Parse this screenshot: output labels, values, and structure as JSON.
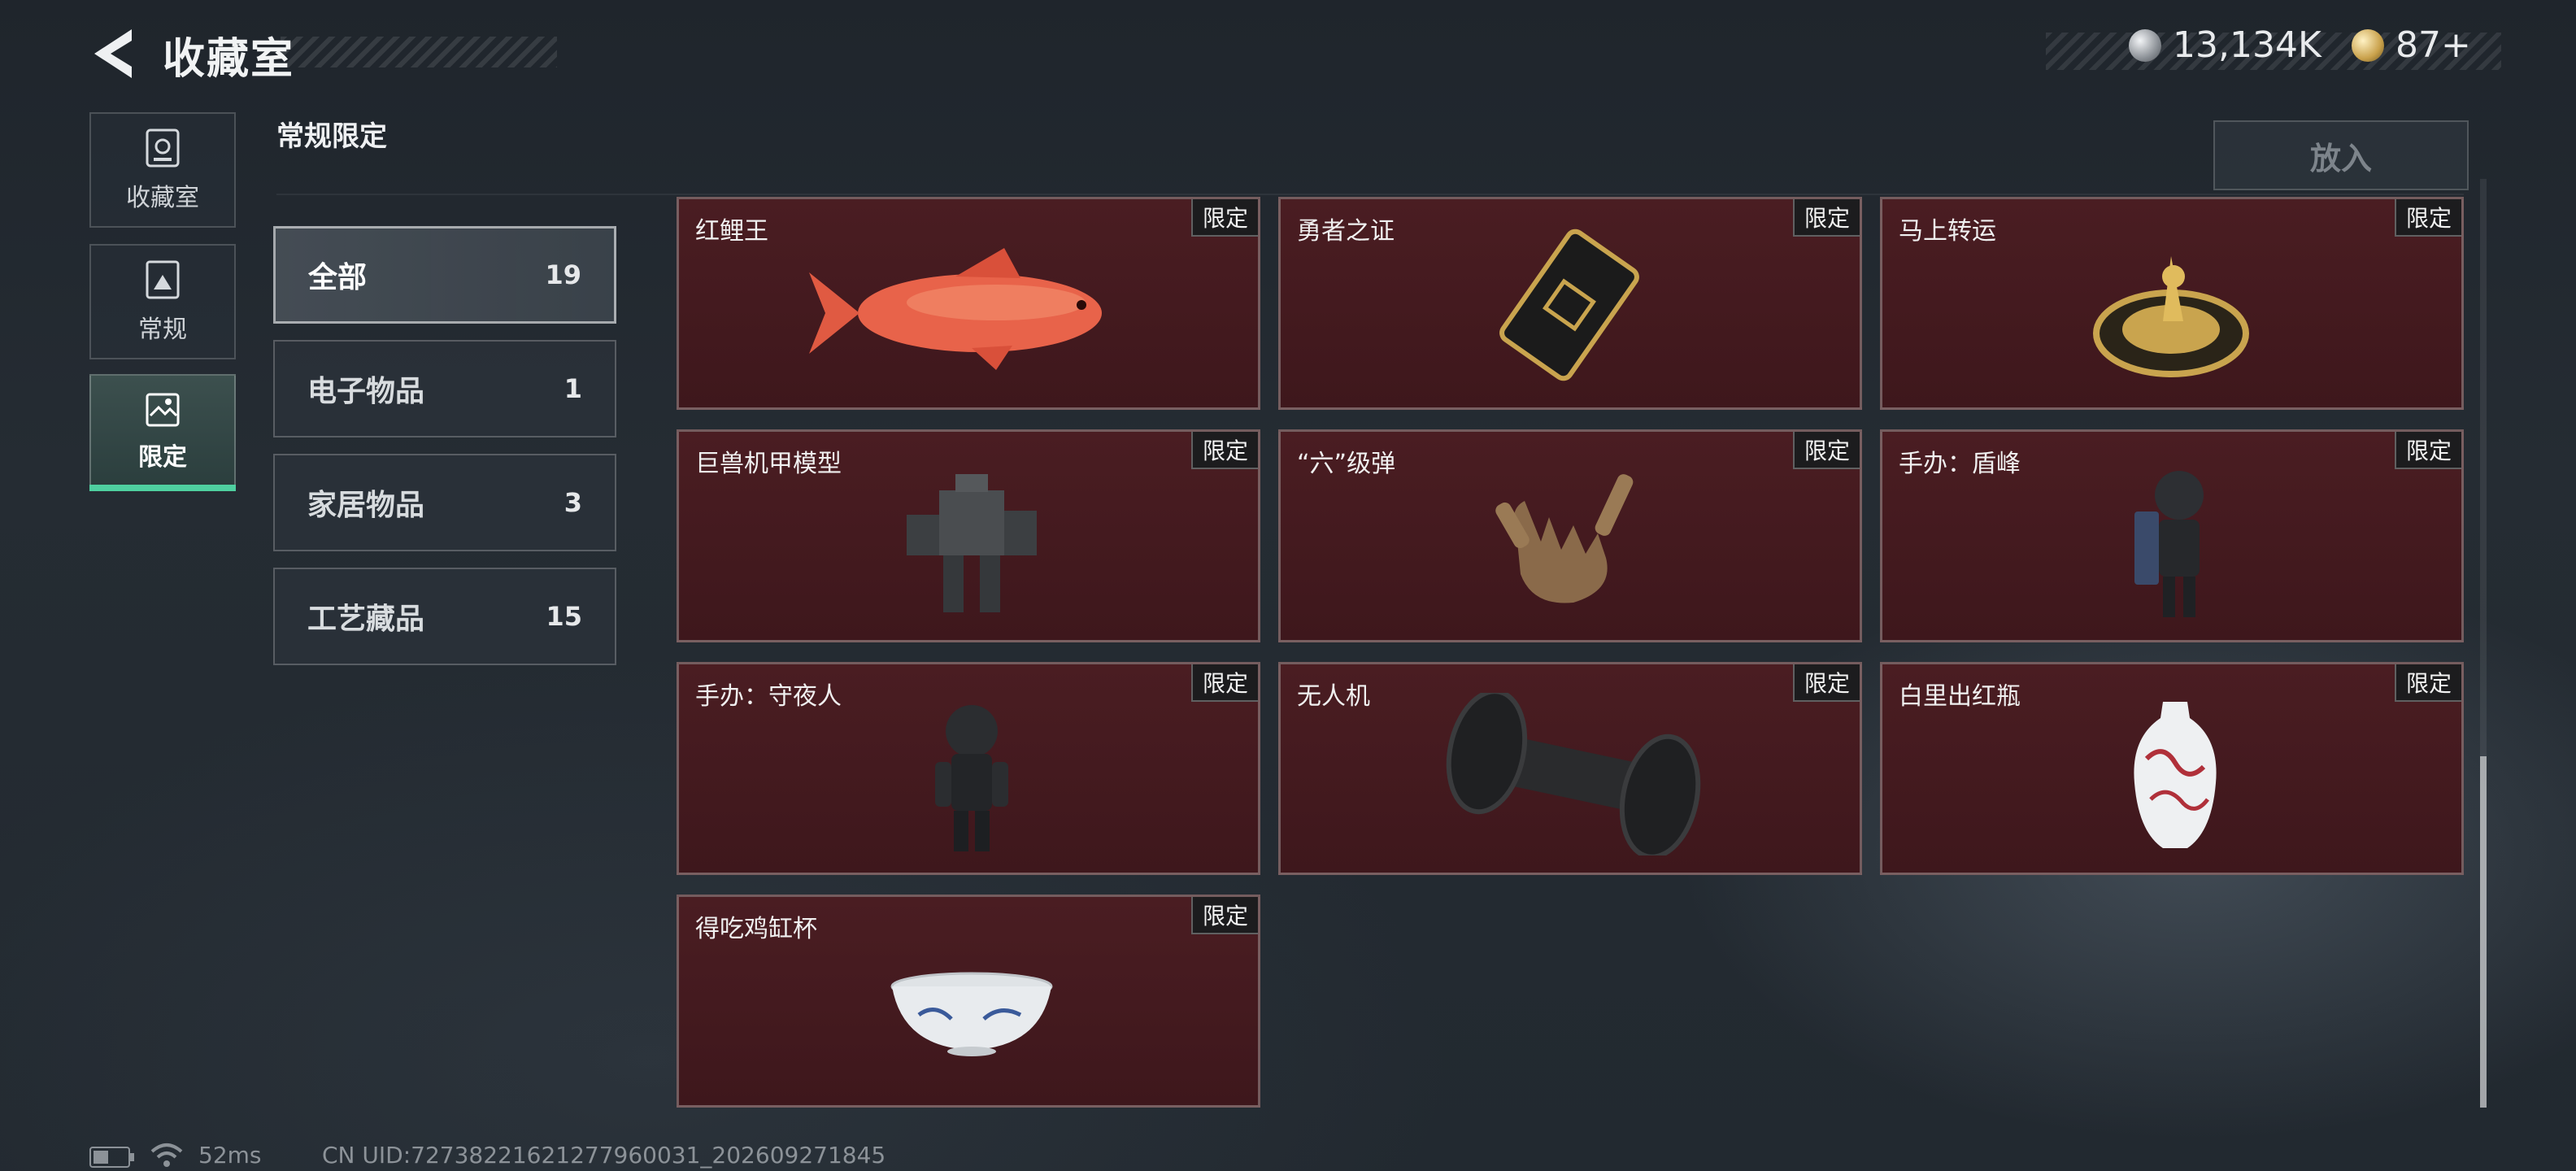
{
  "header": {
    "title": "收藏室",
    "currency": [
      {
        "icon": "silver-coin-icon",
        "value": "13,134K"
      },
      {
        "icon": "gold-coin-icon",
        "value": "87+"
      }
    ]
  },
  "nav": {
    "items": [
      {
        "label": "收藏室",
        "icon": "collection-room-icon"
      },
      {
        "label": "常规",
        "icon": "regular-card-icon"
      },
      {
        "label": "限定",
        "icon": "limited-image-icon",
        "active": true
      }
    ]
  },
  "section_title": "常规限定",
  "put_button": "放入",
  "categories": [
    {
      "name": "全部",
      "count": "19",
      "active": true
    },
    {
      "name": "电子物品",
      "count": "1"
    },
    {
      "name": "家居物品",
      "count": "3"
    },
    {
      "name": "工艺藏品",
      "count": "15"
    }
  ],
  "items": [
    {
      "name": "红鲤王",
      "tag": "限定",
      "icon": "red-carp-icon"
    },
    {
      "name": "勇者之证",
      "tag": "限定",
      "icon": "hero-badge-card-icon"
    },
    {
      "name": "马上转运",
      "tag": "限定",
      "icon": "golden-horse-disc-icon"
    },
    {
      "name": "巨兽机甲模型",
      "tag": "限定",
      "icon": "mech-model-icon"
    },
    {
      "name": "“六”级弹",
      "tag": "限定",
      "icon": "six-gesture-hand-icon"
    },
    {
      "name": "手办：盾峰",
      "tag": "限定",
      "icon": "figure-shield-icon"
    },
    {
      "name": "手办：守夜人",
      "tag": "限定",
      "icon": "figure-nightwatch-icon"
    },
    {
      "name": "无人机",
      "tag": "限定",
      "icon": "drone-roller-icon"
    },
    {
      "name": "白里出红瓶",
      "tag": "限定",
      "icon": "porcelain-vase-icon"
    },
    {
      "name": "得吃鸡缸杯",
      "tag": "限定",
      "icon": "porcelain-cup-icon"
    }
  ],
  "status": {
    "ping": "52ms",
    "uid": "CN UID:7273822162127796003​1_202609271845"
  },
  "colors": {
    "accent": "#4fd0a0",
    "card_bg": "#4a1d22"
  }
}
